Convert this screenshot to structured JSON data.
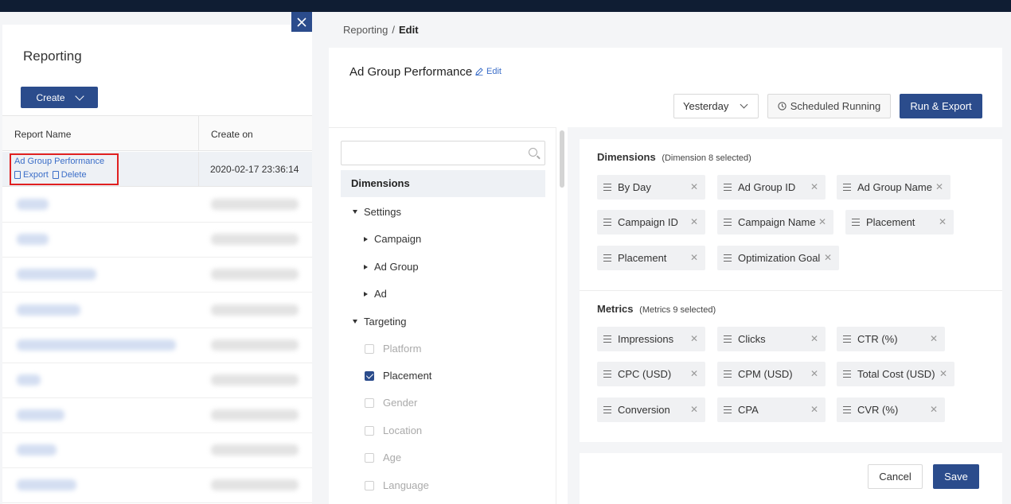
{
  "left": {
    "title": "Reporting",
    "create_label": "Create",
    "columns": [
      "Report Name",
      "Create on"
    ],
    "first_row": {
      "name": "Ad Group Performance",
      "export_label": "Export",
      "delete_label": "Delete",
      "created": "2020-02-17 23:36:14"
    }
  },
  "drawer": {
    "breadcrumb": {
      "parent": "Reporting",
      "separator": "/",
      "current": "Edit"
    },
    "report_title": "Ad Group Performance",
    "edit_label": "Edit",
    "date_range": "Yesterday",
    "scheduled_label": "Scheduled Running",
    "run_label": "Run & Export",
    "tree": {
      "heading": "Dimensions",
      "settings": "Settings",
      "settings_children": [
        "Campaign",
        "Ad Group",
        "Ad"
      ],
      "targeting": "Targeting",
      "targeting_children": [
        {
          "label": "Platform",
          "checked": false
        },
        {
          "label": "Placement",
          "checked": true
        },
        {
          "label": "Gender",
          "checked": false
        },
        {
          "label": "Location",
          "checked": false
        },
        {
          "label": "Age",
          "checked": false
        },
        {
          "label": "Language",
          "checked": false
        }
      ]
    },
    "dimensions": {
      "title": "Dimensions",
      "subtitle": "(Dimension 8 selected)",
      "chips": [
        "By Day",
        "Ad Group ID",
        "Ad Group Name",
        "Campaign ID",
        "Campaign Name",
        "Placement",
        "Placement",
        "Optimization Goal"
      ]
    },
    "metrics": {
      "title": "Metrics",
      "subtitle": "(Metrics 9 selected)",
      "chips": [
        "Impressions",
        "Clicks",
        "CTR (%)",
        "CPC (USD)",
        "CPM (USD)",
        "Total Cost (USD)",
        "Conversion",
        "CPA",
        "CVR (%)"
      ]
    },
    "cancel_label": "Cancel",
    "save_label": "Save"
  },
  "colors": {
    "primary": "#2b4c8c",
    "link": "#3b6ec8",
    "highlight": "#e02020"
  }
}
